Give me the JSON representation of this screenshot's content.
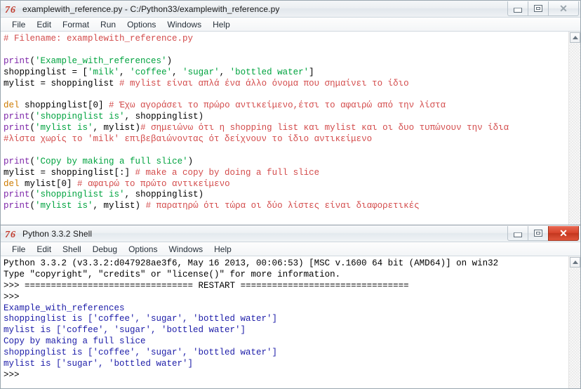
{
  "editor": {
    "title": "examplewith_reference.py - C:/Python33/examplewith_reference.py",
    "logo_name": "python-idle-logo",
    "menu": [
      "File",
      "Edit",
      "Format",
      "Run",
      "Options",
      "Windows",
      "Help"
    ],
    "window_buttons": {
      "minimize": "–",
      "maximize": "□",
      "close": "✕"
    },
    "code_lines": [
      [
        {
          "t": "# Filename: examplewith_reference.py",
          "c": "cmt"
        }
      ],
      [
        {
          "t": "",
          "c": ""
        }
      ],
      [
        {
          "t": "print",
          "c": "bi"
        },
        {
          "t": "(",
          "c": ""
        },
        {
          "t": "'Example_with_references'",
          "c": "str"
        },
        {
          "t": ")",
          "c": ""
        }
      ],
      [
        {
          "t": "shoppinglist = [",
          "c": ""
        },
        {
          "t": "'milk'",
          "c": "str"
        },
        {
          "t": ", ",
          "c": ""
        },
        {
          "t": "'coffee'",
          "c": "str"
        },
        {
          "t": ", ",
          "c": ""
        },
        {
          "t": "'sugar'",
          "c": "str"
        },
        {
          "t": ", ",
          "c": ""
        },
        {
          "t": "'bottled water'",
          "c": "str"
        },
        {
          "t": "]",
          "c": ""
        }
      ],
      [
        {
          "t": "mylist = shoppinglist ",
          "c": ""
        },
        {
          "t": "# mylist είναι απλά ένα άλλο όνομα που σημαίνει το ίδιο",
          "c": "cmt"
        }
      ],
      [
        {
          "t": "",
          "c": ""
        }
      ],
      [
        {
          "t": "del",
          "c": "kw"
        },
        {
          "t": " shoppinglist[0] ",
          "c": ""
        },
        {
          "t": "# Έχω αγοράσει το πρώρο αντικείμενο,έτσι το αφαιρώ από την λίστα",
          "c": "cmt"
        }
      ],
      [
        {
          "t": "print",
          "c": "bi"
        },
        {
          "t": "(",
          "c": ""
        },
        {
          "t": "'shoppinglist is'",
          "c": "str"
        },
        {
          "t": ", shoppinglist)",
          "c": ""
        }
      ],
      [
        {
          "t": "print",
          "c": "bi"
        },
        {
          "t": "(",
          "c": ""
        },
        {
          "t": "'mylist is'",
          "c": "str"
        },
        {
          "t": ", mylist)",
          "c": ""
        },
        {
          "t": "# σημειώνω ότι η shopping list και mylist και οι δυο τυπώνουν την ίδια",
          "c": "cmt"
        }
      ],
      [
        {
          "t": "#λίστα χωρίς το 'milk' επιβεβαιώνοντας ότ δείχνουν το ίδιο αντικείμενο",
          "c": "cmt"
        }
      ],
      [
        {
          "t": "",
          "c": ""
        }
      ],
      [
        {
          "t": "print",
          "c": "bi"
        },
        {
          "t": "(",
          "c": ""
        },
        {
          "t": "'Copy by making a full slice'",
          "c": "str"
        },
        {
          "t": ")",
          "c": ""
        }
      ],
      [
        {
          "t": "mylist = shoppinglist[:] ",
          "c": ""
        },
        {
          "t": "# make a copy by doing a full slice",
          "c": "cmt"
        }
      ],
      [
        {
          "t": "del",
          "c": "kw"
        },
        {
          "t": " mylist[0] ",
          "c": ""
        },
        {
          "t": "# αφαιρώ το πρώτο αντικείμενο",
          "c": "cmt"
        }
      ],
      [
        {
          "t": "print",
          "c": "bi"
        },
        {
          "t": "(",
          "c": ""
        },
        {
          "t": "'shoppinglist is'",
          "c": "str"
        },
        {
          "t": ", shoppinglist)",
          "c": ""
        }
      ],
      [
        {
          "t": "print",
          "c": "bi"
        },
        {
          "t": "(",
          "c": ""
        },
        {
          "t": "'mylist is'",
          "c": "str"
        },
        {
          "t": ", mylist) ",
          "c": ""
        },
        {
          "t": "# παρατηρώ ότι τώρα οι δύο λίστες είναι διαφορετικές",
          "c": "cmt"
        }
      ]
    ]
  },
  "shell": {
    "title": "Python 3.3.2 Shell",
    "logo_name": "python-idle-logo",
    "menu": [
      "File",
      "Edit",
      "Shell",
      "Debug",
      "Options",
      "Windows",
      "Help"
    ],
    "window_buttons": {
      "minimize": "–",
      "maximize": "□",
      "close": "✕"
    },
    "output_lines": [
      [
        {
          "t": "Python 3.3.2 (v3.3.2:d047928ae3f6, May 16 2013, 00:06:53) [MSC v.1600 64 bit (AMD64)] on win32",
          "c": "sh-black"
        }
      ],
      [
        {
          "t": "Type \"copyright\", \"credits\" or \"license()\" for more information.",
          "c": "sh-black"
        }
      ],
      [
        {
          "t": ">>> ",
          "c": "sh-prompt"
        },
        {
          "t": "================================ RESTART ================================",
          "c": "sh-black"
        }
      ],
      [
        {
          "t": ">>> ",
          "c": "sh-prompt"
        }
      ],
      [
        {
          "t": "Example_with_references",
          "c": "sh-out"
        }
      ],
      [
        {
          "t": "shoppinglist is ['coffee', 'sugar', 'bottled water']",
          "c": "sh-out"
        }
      ],
      [
        {
          "t": "mylist is ['coffee', 'sugar', 'bottled water']",
          "c": "sh-out"
        }
      ],
      [
        {
          "t": "Copy by making a full slice",
          "c": "sh-out"
        }
      ],
      [
        {
          "t": "shoppinglist is ['coffee', 'sugar', 'bottled water']",
          "c": "sh-out"
        }
      ],
      [
        {
          "t": "mylist is ['sugar', 'bottled water']",
          "c": "sh-out"
        }
      ],
      [
        {
          "t": ">>> ",
          "c": "sh-prompt"
        }
      ]
    ]
  },
  "colors": {
    "comment": "#d34b4b",
    "string": "#00a33f",
    "keyword": "#cc7a00",
    "builtin": "#7d26a8",
    "shell_output": "#1c1ca8",
    "close_red": "#d9452c"
  }
}
